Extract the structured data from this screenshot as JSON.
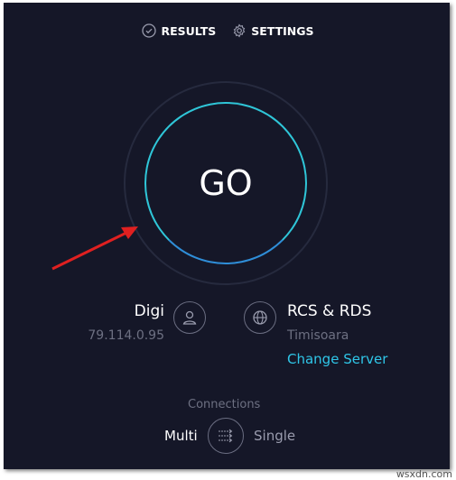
{
  "nav": {
    "results": "RESULTS",
    "settings": "SETTINGS"
  },
  "go_label": "GO",
  "provider": {
    "name": "Digi",
    "ip": "79.114.0.95"
  },
  "server": {
    "name": "RCS & RDS",
    "location": "Timisoara",
    "change": "Change Server"
  },
  "connections": {
    "label": "Connections",
    "multi": "Multi",
    "single": "Single"
  },
  "watermark": "wsxdn.com",
  "colors": {
    "background": "#151728",
    "accent": "#2fc6d8",
    "link": "#2fc6e8",
    "arrow": "#e02020"
  }
}
